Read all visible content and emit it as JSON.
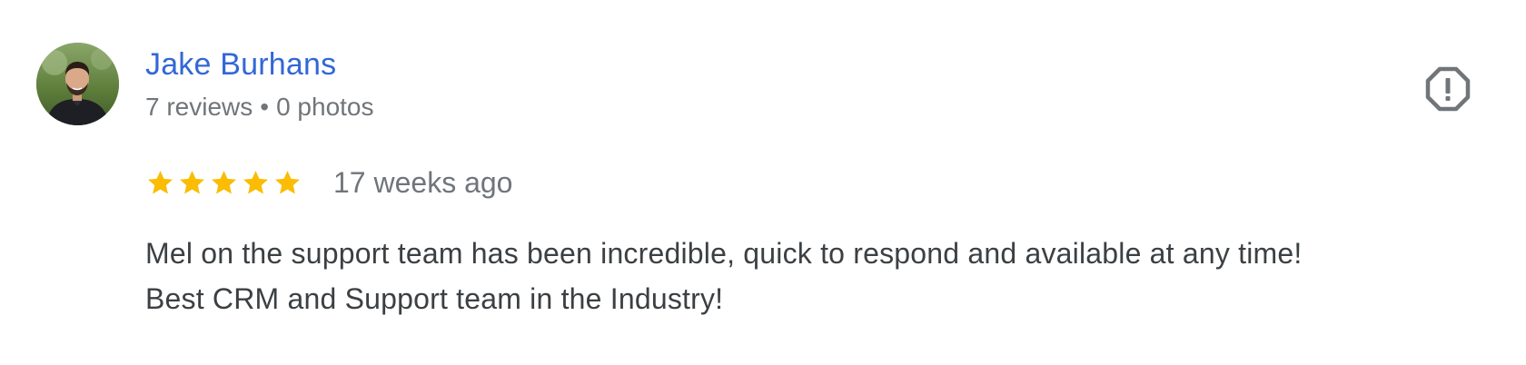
{
  "reviewer": {
    "name": "Jake Burhans",
    "reviews_count": "7 reviews",
    "separator": "•",
    "photos_count": "0 photos"
  },
  "rating": {
    "stars": 5,
    "max_stars": 5,
    "date": "17 weeks ago"
  },
  "review": {
    "lines": [
      "Mel on the support team has been incredible, quick to respond and available at any time!",
      "Best CRM and Support team in the Industry!"
    ]
  },
  "icons": {
    "flag": "report-flag-icon",
    "star": "star-icon",
    "avatar": "avatar"
  },
  "colors": {
    "name_link": "#3367d6",
    "meta_text": "#70757a",
    "body_text": "#3c4043",
    "star_fill": "#fbbc04",
    "flag_icon": "#70757a"
  }
}
